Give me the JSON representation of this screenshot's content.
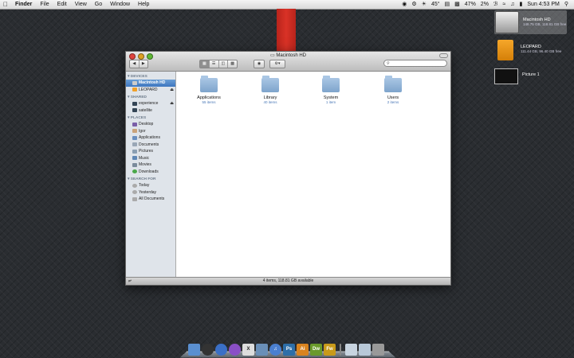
{
  "menubar": {
    "app_name": "Finder",
    "menus": [
      "File",
      "Edit",
      "View",
      "Go",
      "Window",
      "Help"
    ],
    "status": {
      "temperature": "45°",
      "battery": "47%",
      "misc": "2%",
      "clock": "Sun 4:53 PM"
    }
  },
  "desktop": {
    "icons": [
      {
        "name": "Macintosh HD",
        "detail": "148.75 GB, 118.81 GB free"
      },
      {
        "name": "LEOPARD",
        "detail": "111.44 GB, 96.40 GB free"
      },
      {
        "name": "Picture 1",
        "detail": ""
      }
    ]
  },
  "window": {
    "title": "Macintosh HD",
    "search_placeholder": "",
    "sidebar": {
      "devices_header": "DEVICES",
      "devices": [
        "Macintosh HD",
        "LEOPARD"
      ],
      "shared_header": "SHARED",
      "shared": [
        "experience",
        "satellite"
      ],
      "places_header": "PLACES",
      "places": [
        "Desktop",
        "Igor",
        "Applications",
        "Documents",
        "Pictures",
        "Music",
        "Movies",
        "Downloads"
      ],
      "search_header": "SEARCH FOR",
      "search_for": [
        "Today",
        "Yesterday",
        "All Documents"
      ]
    },
    "folders": [
      {
        "name": "Applications",
        "sub": "55 items"
      },
      {
        "name": "Library",
        "sub": "40 items"
      },
      {
        "name": "System",
        "sub": "1 item"
      },
      {
        "name": "Users",
        "sub": "2 items"
      }
    ],
    "status": "4 items, 118.81 GB available"
  },
  "dock": {
    "labels": [
      "Ps",
      "Ai",
      "Dw",
      "Fw"
    ],
    "colors": {
      "ps": "#2d6ea8",
      "ai": "#d9831f",
      "dw": "#6a9a2b",
      "fw": "#c89a1a"
    }
  }
}
